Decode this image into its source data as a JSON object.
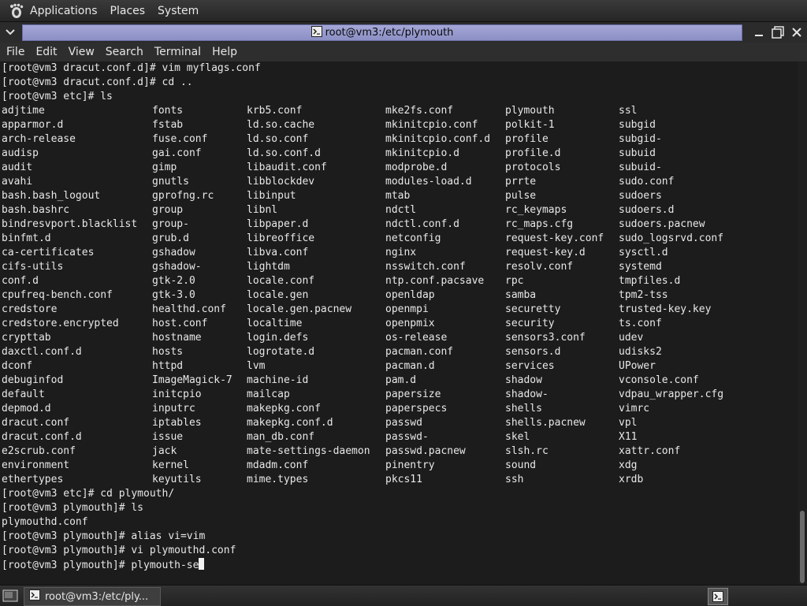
{
  "top_panel": {
    "menus": [
      "Applications",
      "Places",
      "System"
    ]
  },
  "window": {
    "title": "root@vm3:/etc/plymouth"
  },
  "menubar": {
    "items": [
      "File",
      "Edit",
      "View",
      "Search",
      "Terminal",
      "Help"
    ]
  },
  "terminal": {
    "lines_before": [
      "[root@vm3 dracut.conf.d]# vim myflags.conf",
      "[root@vm3 dracut.conf.d]# cd ..",
      "[root@vm3 etc]# ls"
    ],
    "ls_columns": [
      [
        "adjtime",
        "apparmor.d",
        "arch-release",
        "audisp",
        "audit",
        "avahi",
        "bash.bash_logout",
        "bash.bashrc",
        "bindresvport.blacklist",
        "binfmt.d",
        "ca-certificates",
        "cifs-utils",
        "conf.d",
        "cpufreq-bench.conf",
        "credstore",
        "credstore.encrypted",
        "crypttab",
        "daxctl.conf.d",
        "dconf",
        "debuginfod",
        "default",
        "depmod.d",
        "dracut.conf",
        "dracut.conf.d",
        "e2scrub.conf",
        "environment",
        "ethertypes"
      ],
      [
        "fonts",
        "fstab",
        "fuse.conf",
        "gai.conf",
        "gimp",
        "gnutls",
        "gprofng.rc",
        "group",
        "group-",
        "grub.d",
        "gshadow",
        "gshadow-",
        "gtk-2.0",
        "gtk-3.0",
        "healthd.conf",
        "host.conf",
        "hostname",
        "hosts",
        "httpd",
        "ImageMagick-7",
        "initcpio",
        "inputrc",
        "iptables",
        "issue",
        "jack",
        "kernel",
        "keyutils"
      ],
      [
        "krb5.conf",
        "ld.so.cache",
        "ld.so.conf",
        "ld.so.conf.d",
        "libaudit.conf",
        "libblockdev",
        "libinput",
        "libnl",
        "libpaper.d",
        "libreoffice",
        "libva.conf",
        "lightdm",
        "locale.conf",
        "locale.gen",
        "locale.gen.pacnew",
        "localtime",
        "login.defs",
        "logrotate.d",
        "lvm",
        "machine-id",
        "mailcap",
        "makepkg.conf",
        "makepkg.conf.d",
        "man_db.conf",
        "mate-settings-daemon",
        "mdadm.conf",
        "mime.types"
      ],
      [
        "mke2fs.conf",
        "mkinitcpio.conf",
        "mkinitcpio.conf.d",
        "mkinitcpio.d",
        "modprobe.d",
        "modules-load.d",
        "mtab",
        "ndctl",
        "ndctl.conf.d",
        "netconfig",
        "nginx",
        "nsswitch.conf",
        "ntp.conf.pacsave",
        "openldap",
        "openmpi",
        "openpmix",
        "os-release",
        "pacman.conf",
        "pacman.d",
        "pam.d",
        "papersize",
        "paperspecs",
        "passwd",
        "passwd-",
        "passwd.pacnew",
        "pinentry",
        "pkcs11"
      ],
      [
        "plymouth",
        "polkit-1",
        "profile",
        "profile.d",
        "protocols",
        "prrte",
        "pulse",
        "rc_keymaps",
        "rc_maps.cfg",
        "request-key.conf",
        "request-key.d",
        "resolv.conf",
        "rpc",
        "samba",
        "securetty",
        "security",
        "sensors3.conf",
        "sensors.d",
        "services",
        "shadow",
        "shadow-",
        "shells",
        "shells.pacnew",
        "skel",
        "slsh.rc",
        "sound",
        "ssh"
      ],
      [
        "ssl",
        "subgid",
        "subgid-",
        "subuid",
        "subuid-",
        "sudo.conf",
        "sudoers",
        "sudoers.d",
        "sudoers.pacnew",
        "sudo_logsrvd.conf",
        "sysctl.d",
        "systemd",
        "tmpfiles.d",
        "tpm2-tss",
        "trusted-key.key",
        "ts.conf",
        "udev",
        "udisks2",
        "UPower",
        "vconsole.conf",
        "vdpau_wrapper.cfg",
        "vimrc",
        "vpl",
        "X11",
        "xattr.conf",
        "xdg",
        "xrdb"
      ]
    ],
    "lines_after": [
      "[root@vm3 etc]# cd plymouth/",
      "[root@vm3 plymouth]# ls",
      "plymouthd.conf",
      "[root@vm3 plymouth]# alias vi=vim",
      "[root@vm3 plymouth]# vi plymouthd.conf",
      "[root@vm3 plymouth]# plymouth-se"
    ]
  },
  "taskbar": {
    "task_label": "root@vm3:/etc/ply..."
  },
  "icons": {
    "panel_logo": "gnome-foot-icon",
    "window_collapse": "chevron-down-icon",
    "window_terminal": "terminal-icon",
    "minimize": "minimize-icon",
    "maximize": "maximize-icon",
    "close": "close-icon",
    "show_desktop": "show-desktop-icon",
    "tray": "terminal-tray-icon"
  }
}
